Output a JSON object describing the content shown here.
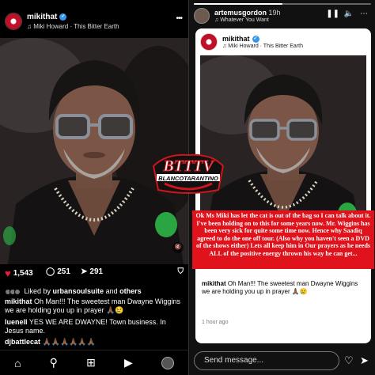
{
  "left_post": {
    "username": "mikithat",
    "song": "Miki Howard · This Bitter Earth",
    "more_label": "•••",
    "likes": "1,543",
    "comments": "251",
    "shares": "291",
    "liked_by_prefix": "Liked by ",
    "liked_by_user": "urbansoulsuite",
    "liked_by_suffix": " and ",
    "liked_by_others": "others",
    "caption_user": "mikithat",
    "caption_text": "Oh Man!!! The sweetest man Dwayne Wiggins we are holding you up in prayer 🙏🏾😢",
    "comment1_user": "luenell",
    "comment1_text": "YES WE ARE DWAYNE! Town business. In Jesus name.",
    "comment2_user": "djbattlecat",
    "comment2_text": "🙏🏾🙏🏾🙏🏾🙏🏾🙏🏾🙏🏾"
  },
  "logo": {
    "line1": "BTTTV",
    "line2": "BLANCOTARANTINO"
  },
  "story": {
    "username": "artemusgordon",
    "time": "19h",
    "song": "♫ Whatever You Want",
    "card_username": "mikithat",
    "card_song": "Miki Howard · This Bitter Earth",
    "red_text": "Ok Ms Miki has let the cat is out of the bag so I can talk about it. I've been holding on to this for some years now. Mr. Wiggins has been very sick for quite some time now. Hence why Saadiq agreed to do the one off tour. (Also why you haven't seen a DVD of the shows either) Lets all keep him in Our prayers  as he needs ALL of the positive energy thrown his way he can get...",
    "card_comment_user": "mikithat",
    "card_comment_text": "Oh Man!!! The sweetest man Dwayne Wiggins we are holding you up in prayer 🙏🏾😢",
    "card_time": "1 hour ago",
    "send_placeholder": "Send message...",
    "progress": 0.5
  },
  "colors": {
    "like_red": "#ed1c3a",
    "verified_blue": "#3797f0",
    "banner_red": "#e0121b"
  }
}
